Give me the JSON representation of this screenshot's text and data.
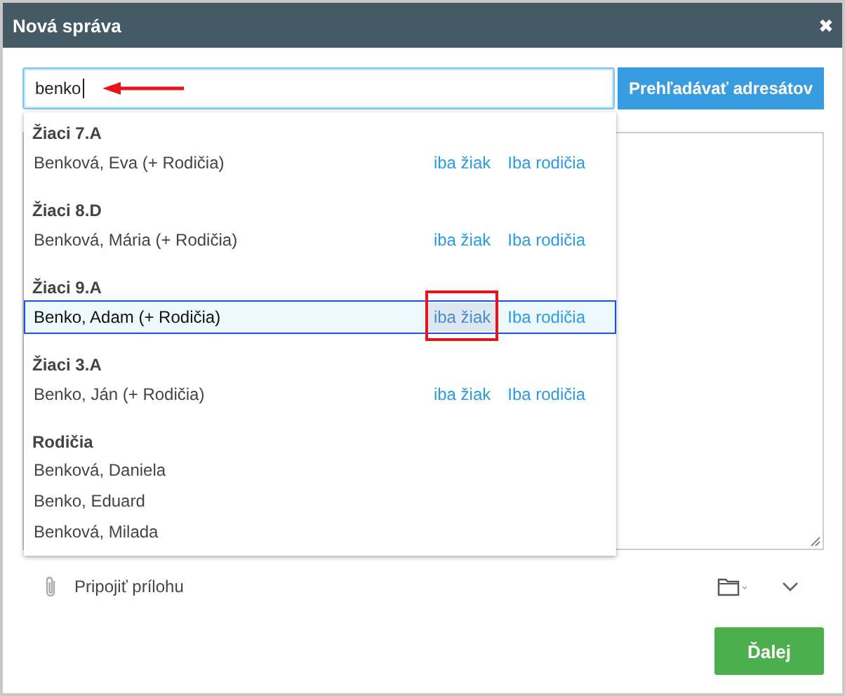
{
  "window": {
    "title": "Nová správa",
    "close": "✖"
  },
  "search": {
    "value": "benko",
    "button": "Prehľadávať adresátov"
  },
  "suggestions": [
    {
      "heading": "Žiaci 7.A",
      "items": [
        {
          "kind": "student",
          "name": "Benková, Eva (+ Rodičia)",
          "selected": false,
          "links": [
            {
              "label": "iba žiak",
              "hovered": false
            },
            {
              "label": "Iba rodičia",
              "hovered": false
            }
          ]
        }
      ]
    },
    {
      "heading": "Žiaci 8.D",
      "items": [
        {
          "kind": "student",
          "name": "Benková, Mária (+ Rodičia)",
          "selected": false,
          "links": [
            {
              "label": "iba žiak",
              "hovered": false
            },
            {
              "label": "Iba rodičia",
              "hovered": false
            }
          ]
        }
      ]
    },
    {
      "heading": "Žiaci 9.A",
      "items": [
        {
          "kind": "student",
          "name": "Benko, Adam (+ Rodičia)",
          "selected": true,
          "links": [
            {
              "label": "iba žiak",
              "hovered": true
            },
            {
              "label": "Iba rodičia",
              "hovered": false
            }
          ]
        }
      ]
    },
    {
      "heading": "Žiaci 3.A",
      "items": [
        {
          "kind": "student",
          "name": "Benko, Ján (+ Rodičia)",
          "selected": false,
          "links": [
            {
              "label": "iba žiak",
              "hovered": false
            },
            {
              "label": "Iba rodičia",
              "hovered": false
            }
          ]
        }
      ]
    },
    {
      "heading": "Rodičia",
      "items": [
        {
          "kind": "parent",
          "name": "Benková, Daniela",
          "selected": false
        },
        {
          "kind": "parent",
          "name": "Benko, Eduard",
          "selected": false
        },
        {
          "kind": "parent",
          "name": "Benková, Milada",
          "selected": false
        }
      ]
    }
  ],
  "attachment": {
    "label": "Pripojiť prílohu"
  },
  "next_button": "Ďalej"
}
